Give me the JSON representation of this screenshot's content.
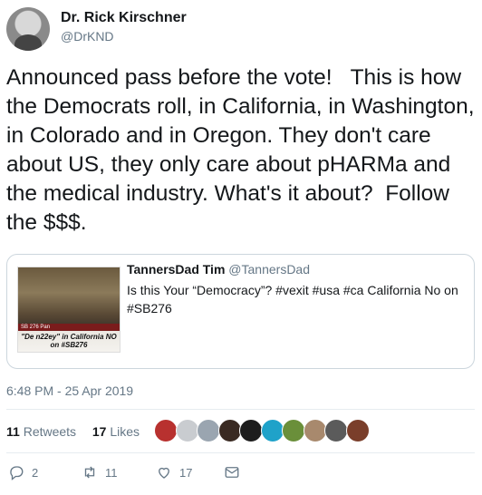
{
  "author": {
    "name": "Dr. Rick Kirschner",
    "handle": "@DrKND"
  },
  "tweet": {
    "text": "Announced pass before the vote!   This is how the Democrats roll, in California, in Washington, in Colorado and in Oregon. They don't care about US, they only care about pHARMa and the medical industry. What's it about?  Follow the $$$."
  },
  "quote": {
    "name": "TannersDad Tim",
    "handle": "@TannersDad",
    "text": "Is this Your “Democracy”? #vexit #usa #ca California No on #SB276",
    "thumb_bar_text": "SB 276  Pan",
    "thumb_caption": "\"De n22ey\" in California NO on #SB276"
  },
  "timestamp": "6:48 PM - 25 Apr 2019",
  "stats": {
    "retweets_count": "11",
    "retweets_label": "Retweets",
    "likes_count": "17",
    "likes_label": "Likes"
  },
  "likers": [
    {
      "color": "#b8312f"
    },
    {
      "color": "#c9ccd0"
    },
    {
      "color": "#9aa5b0"
    },
    {
      "color": "#3a2a22"
    },
    {
      "color": "#1d1d1d"
    },
    {
      "color": "#1fa2c9"
    },
    {
      "color": "#6a8f3a"
    },
    {
      "color": "#a8896d"
    },
    {
      "color": "#5b5b5b"
    },
    {
      "color": "#7a3e2a"
    }
  ],
  "actions": {
    "replies": "2",
    "retweets": "11",
    "likes": "17"
  }
}
